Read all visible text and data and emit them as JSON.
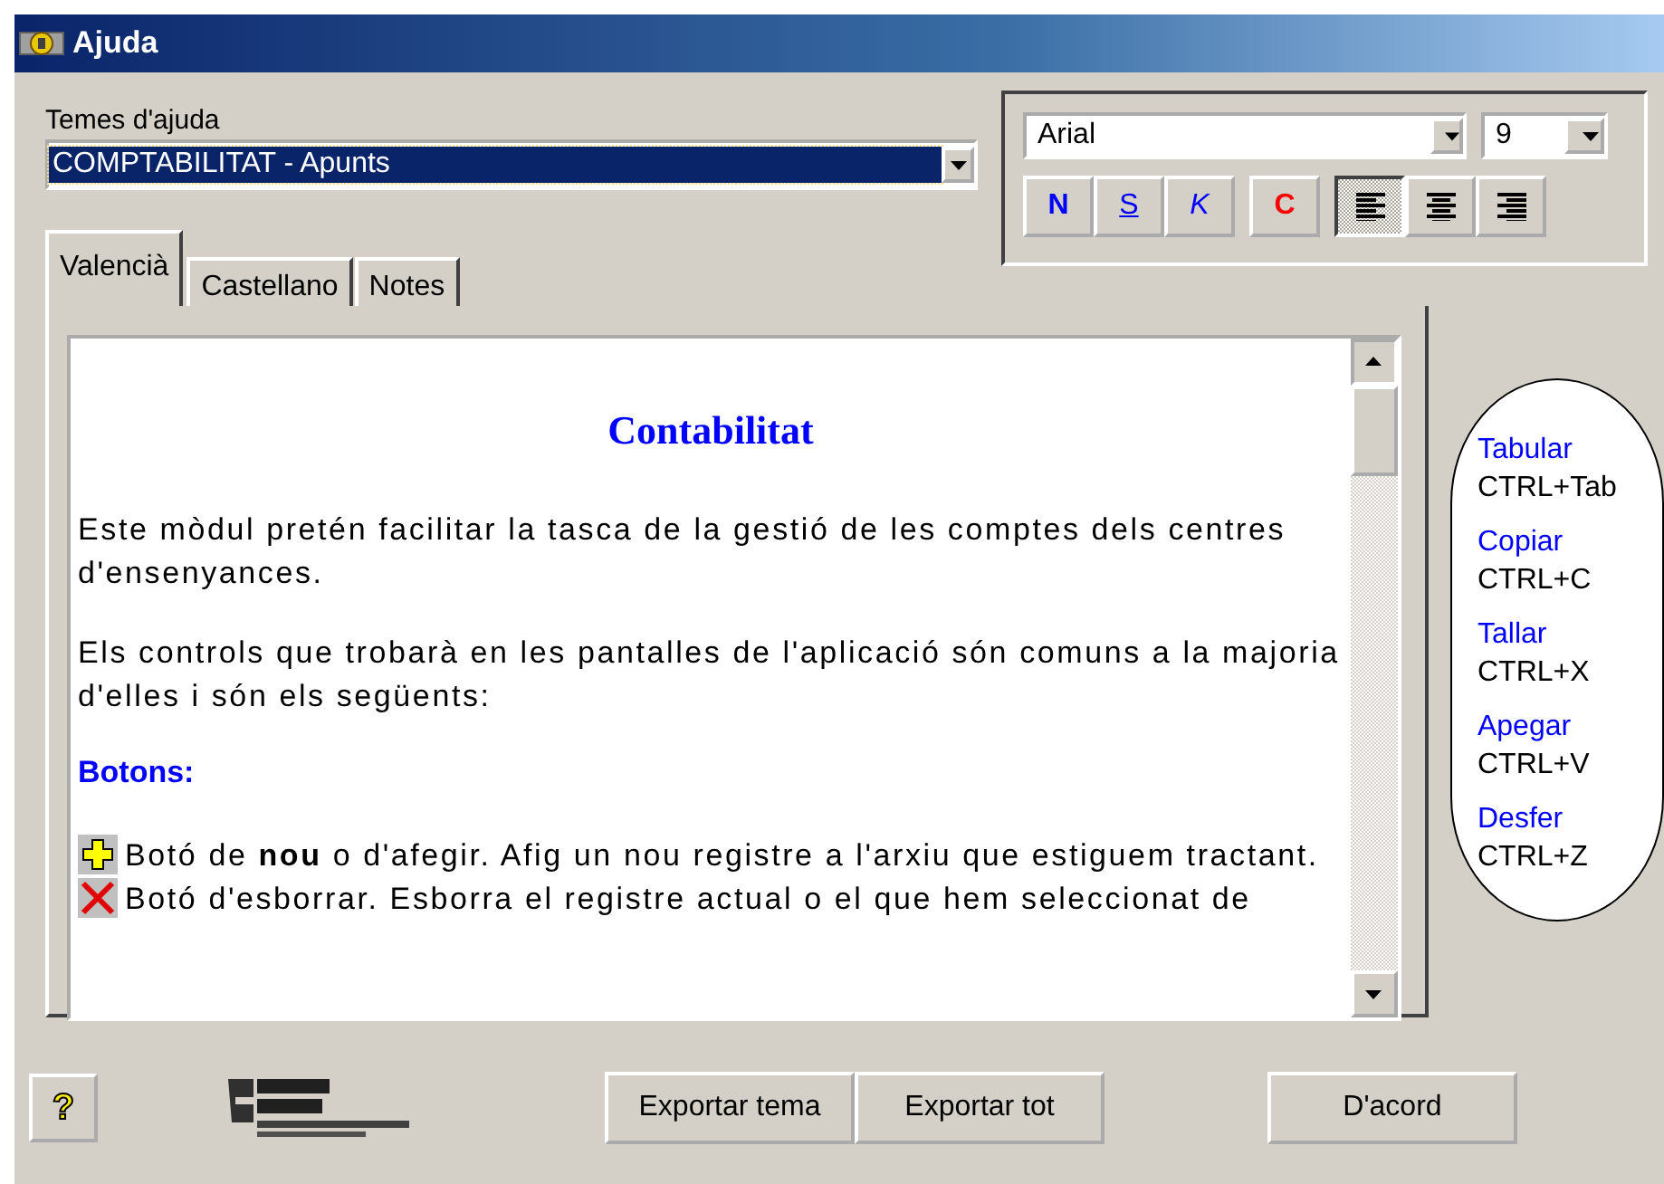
{
  "window": {
    "title": "Ajuda"
  },
  "topics": {
    "label": "Temes d'ajuda",
    "value": "COMPTABILITAT - Apunts"
  },
  "font_panel": {
    "font": "Arial",
    "size": "9",
    "format_buttons": [
      {
        "kind": "bold",
        "label": "N"
      },
      {
        "kind": "underline",
        "label": "S"
      },
      {
        "kind": "italic",
        "label": "K"
      },
      {
        "kind": "color",
        "label": "C"
      }
    ],
    "align_buttons": [
      {
        "kind": "left",
        "selected": true
      },
      {
        "kind": "center",
        "selected": false
      },
      {
        "kind": "right",
        "selected": false
      }
    ]
  },
  "tabs": [
    {
      "label": "Valencià",
      "selected": true
    },
    {
      "label": "Castellano",
      "selected": false
    },
    {
      "label": "Notes",
      "selected": false
    }
  ],
  "document": {
    "title": "Contabilitat",
    "blocks": [
      {
        "kind": "paragraph",
        "text": "Este mòdul pretén facilitar la tasca de la gestió de les comptes dels centres d'ensenyances."
      },
      {
        "kind": "paragraph",
        "text": "Els controls que trobarà en les pantalles de l'aplicació són comuns a la majoria d'elles i són els següents:"
      },
      {
        "kind": "heading",
        "text": "Botons:"
      },
      {
        "kind": "add_item",
        "text": "Botó de **nou** o d'afegir. Afig un nou registre a l'arxiu que estiguem tractant."
      },
      {
        "kind": "delete_item",
        "text": "Botó d'esborrar. Esborra el registre actual o el que hem seleccionat de"
      }
    ]
  },
  "shortcuts": [
    {
      "action": "Tabular",
      "keys": "CTRL+Tab"
    },
    {
      "action": "Copiar",
      "keys": "CTRL+C"
    },
    {
      "action": "Tallar",
      "keys": "CTRL+X"
    },
    {
      "action": "Apegar",
      "keys": "CTRL+V"
    },
    {
      "action": "Desfer",
      "keys": "CTRL+Z"
    }
  ],
  "buttons": {
    "help": "?",
    "export_topic": "Exportar tema",
    "export_all": "Exportar tot",
    "ok": "D'acord"
  }
}
